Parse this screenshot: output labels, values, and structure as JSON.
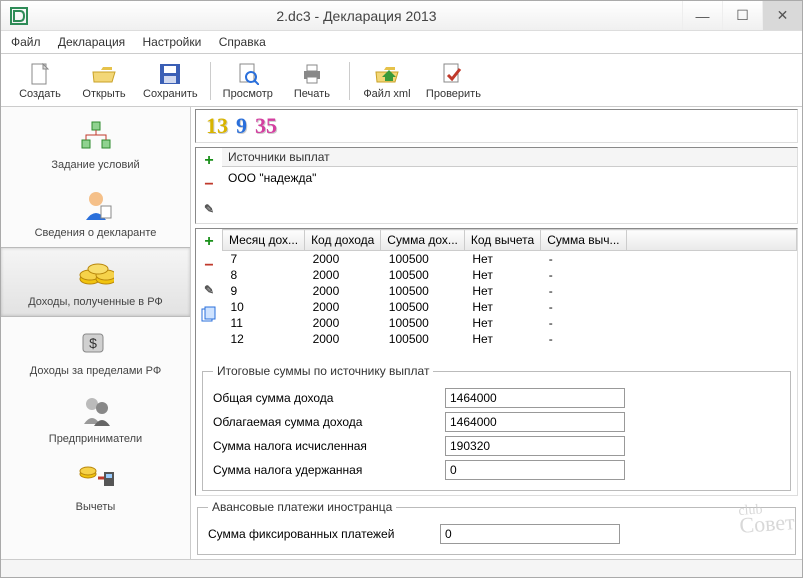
{
  "window": {
    "title": "2.dc3 - Декларация 2013"
  },
  "menu": {
    "file": "Файл",
    "declaration": "Декларация",
    "settings": "Настройки",
    "help": "Справка"
  },
  "toolbar": {
    "create": "Создать",
    "open": "Открыть",
    "save": "Сохранить",
    "preview": "Просмотр",
    "print": "Печать",
    "xml": "Файл xml",
    "check": "Проверить"
  },
  "sidebar": {
    "items": [
      {
        "label": "Задание условий"
      },
      {
        "label": "Сведения о декларанте"
      },
      {
        "label": "Доходы, полученные в РФ"
      },
      {
        "label": "Доходы за пределами РФ"
      },
      {
        "label": "Предприниматели"
      },
      {
        "label": "Вычеты"
      }
    ],
    "active": 2
  },
  "rates": {
    "r13": "13",
    "r9": "9",
    "r35": "35"
  },
  "sources": {
    "header": "Источники выплат",
    "items": [
      "ООО \"надежда\""
    ]
  },
  "grid": {
    "cols": [
      "Месяц дох...",
      "Код дохода",
      "Сумма дох...",
      "Код вычета",
      "Сумма выч..."
    ],
    "rows": [
      {
        "m": "7",
        "code": "2000",
        "sum": "100500",
        "dcode": "Нет",
        "dsum": "-"
      },
      {
        "m": "8",
        "code": "2000",
        "sum": "100500",
        "dcode": "Нет",
        "dsum": "-"
      },
      {
        "m": "9",
        "code": "2000",
        "sum": "100500",
        "dcode": "Нет",
        "dsum": "-"
      },
      {
        "m": "10",
        "code": "2000",
        "sum": "100500",
        "dcode": "Нет",
        "dsum": "-"
      },
      {
        "m": "11",
        "code": "2000",
        "sum": "100500",
        "dcode": "Нет",
        "dsum": "-"
      },
      {
        "m": "12",
        "code": "2000",
        "sum": "100500",
        "dcode": "Нет",
        "dsum": "-"
      }
    ]
  },
  "totals": {
    "legend": "Итоговые суммы по источнику выплат",
    "total_label": "Общая сумма дохода",
    "total": "1464000",
    "taxable_label": "Облагаемая сумма дохода",
    "taxable": "1464000",
    "calc_label": "Сумма налога исчисленная",
    "calc": "190320",
    "withheld_label": "Сумма налога удержанная",
    "withheld": "0"
  },
  "advance": {
    "legend": "Авансовые платежи иностранца",
    "fixed_label": "Сумма фиксированных платежей",
    "fixed": "0"
  },
  "watermark": {
    "line1": "club",
    "line2": "Совет"
  }
}
